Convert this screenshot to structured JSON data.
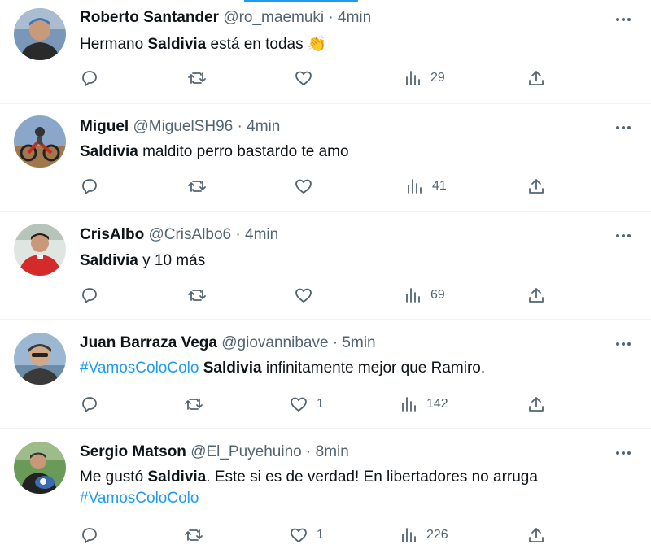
{
  "tweets": [
    {
      "name": "Roberto Santander",
      "handle": "@ro_maemuki",
      "separator": "·",
      "time": "4min",
      "text_parts": {
        "p1": "Hermano ",
        "b1": "Saldivia",
        "p2": " está en todas ",
        "emoji": "👏"
      },
      "likes": "",
      "views": "29",
      "avatar_colors": {
        "bg": "#7a96b8",
        "skin": "#c89a7a",
        "shirt": "#2a2a2a"
      }
    },
    {
      "name": "Miguel",
      "handle": "@MiguelSH96",
      "separator": "·",
      "time": "4min",
      "text_parts": {
        "b1": "Saldivia",
        "p1": " maldito perro bastardo te amo"
      },
      "likes": "",
      "views": "41",
      "avatar_colors": {
        "bg": "#8aa6c8",
        "ground": "#a0784e",
        "bike": "#c03020"
      }
    },
    {
      "name": "CrisAlbo",
      "handle": "@CrisAlbo6",
      "separator": "·",
      "time": "4min",
      "text_parts": {
        "b1": "Saldivia",
        "p1": " y 10 más"
      },
      "likes": "",
      "views": "69",
      "avatar_colors": {
        "bg": "#dfe6e2",
        "skin": "#c99878",
        "shirt": "#d42a2a"
      }
    },
    {
      "name": "Juan Barraza Vega",
      "handle": "@giovannibave",
      "separator": "·",
      "time": "5min",
      "text_parts": {
        "tag": "#VamosColoColo",
        "b1": "Saldivia",
        "p1": " infinitamente mejor que Ramiro."
      },
      "likes": "1",
      "views": "142",
      "avatar_colors": {
        "bg": "#9bb7d2",
        "skin": "#d2a888",
        "shirt": "#3a3a3a"
      }
    },
    {
      "name": "Sergio Matson",
      "handle": "@El_Puyehuino",
      "separator": "·",
      "time": "8min",
      "text_parts": {
        "p1": "Me gustó ",
        "b1": "Saldivia",
        "p2": ". Este si es de verdad! En libertadores no arruga",
        "tag": "#VamosColoColo"
      },
      "likes": "1",
      "views": "226",
      "avatar_colors": {
        "bg": "#6a9a58",
        "skin": "#c89878",
        "shirt": "#222222"
      }
    }
  ],
  "icons": {
    "reply": "reply-icon",
    "retweet": "retweet-icon",
    "like": "like-icon",
    "views": "views-icon",
    "share": "share-icon",
    "more": "more-icon"
  },
  "colors": {
    "accent": "#1d9bf0",
    "secondary_text": "#536471",
    "icon": "#536471"
  }
}
